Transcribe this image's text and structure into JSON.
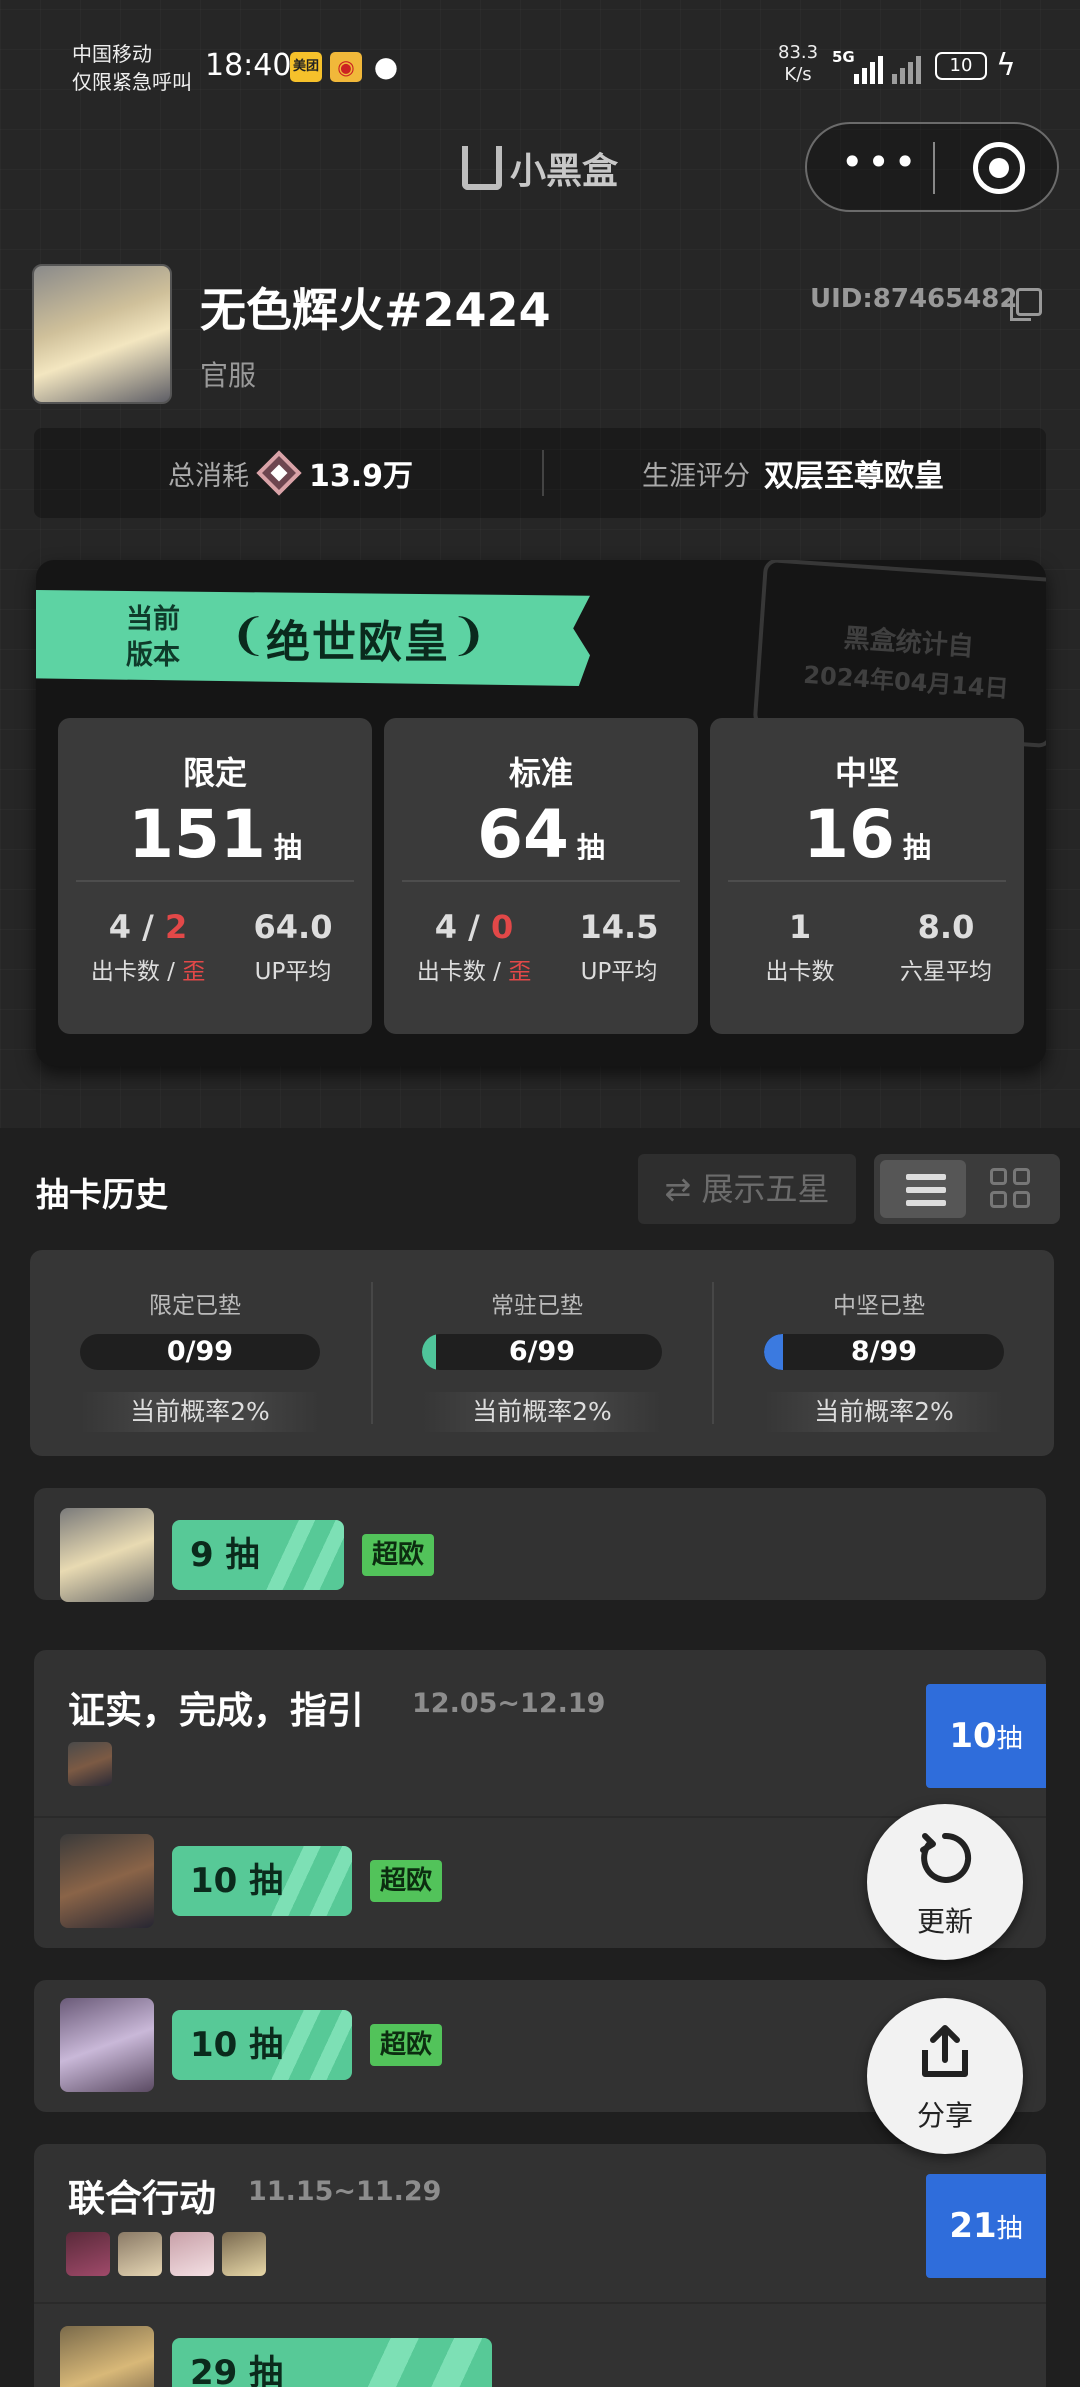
{
  "status_bar": {
    "carrier_line1": "中国移动",
    "carrier_line2": "仅限紧急呼叫",
    "time": "18:40",
    "icon_meituan": "美团",
    "net_speed_value": "83.3",
    "net_speed_unit": "K/s",
    "network": "5G",
    "battery": "10"
  },
  "header": {
    "app_name": "小黑盒"
  },
  "profile": {
    "username": "无色辉火#2424",
    "server": "官服",
    "uid": "UID:87465482"
  },
  "summary": {
    "total_label": "总消耗",
    "total_value": "13.9万",
    "score_label": "生涯评分",
    "score_value": "双层至尊欧皇"
  },
  "version_card": {
    "current_line1": "当前",
    "current_line2": "版本",
    "title": "绝世欧皇",
    "stamp_line1": "黑盒统计自",
    "stamp_line2": "2024年04月14日",
    "pools": [
      {
        "name": "限定",
        "count": "151",
        "unit": "抽",
        "cards": "4",
        "slash": "/",
        "off": "2",
        "cards_label": "出卡数",
        "off_label": "歪",
        "avg": "64.0",
        "avg_label": "UP平均"
      },
      {
        "name": "标准",
        "count": "64",
        "unit": "抽",
        "cards": "4",
        "slash": "/",
        "off": "0",
        "cards_label": "出卡数",
        "off_label": "歪",
        "avg": "14.5",
        "avg_label": "UP平均"
      },
      {
        "name": "中坚",
        "count": "16",
        "unit": "抽",
        "cards": "1",
        "cards_label": "出卡数",
        "avg": "8.0",
        "avg_label": "六星平均"
      }
    ]
  },
  "history": {
    "title": "抽卡历史",
    "toggle_label": "展示五星",
    "pity": [
      {
        "label": "限定已垫",
        "value": "0/99",
        "fraction": 0.0,
        "color": "#1f1f1f",
        "rate": "当前概率2%"
      },
      {
        "label": "常驻已垫",
        "value": "6/99",
        "fraction": 0.06,
        "color": "#4fc49a",
        "rate": "当前概率2%"
      },
      {
        "label": "中坚已垫",
        "value": "8/99",
        "fraction": 0.08,
        "color": "#3b7ae0",
        "rate": "当前概率2%"
      }
    ],
    "entries": [
      {
        "pulls": "9 抽",
        "tag": "超欧"
      },
      {
        "banner": "证实，完成，指引",
        "date": "12.05~12.19",
        "count": "10",
        "unit": "抽",
        "pulls": "10 抽",
        "tag": "超欧"
      },
      {
        "pulls": "10 抽",
        "tag": "超欧"
      },
      {
        "banner": "联合行动",
        "date": "11.15~11.29",
        "count": "21",
        "unit": "抽",
        "pulls": "29 抽"
      }
    ]
  },
  "fab": {
    "refresh_label": "更新",
    "share_label": "分享"
  },
  "colors": {
    "accent_green": "#5dd3a3",
    "badge_blue": "#2f6ddb",
    "lucky_tag": "#52c35a"
  }
}
